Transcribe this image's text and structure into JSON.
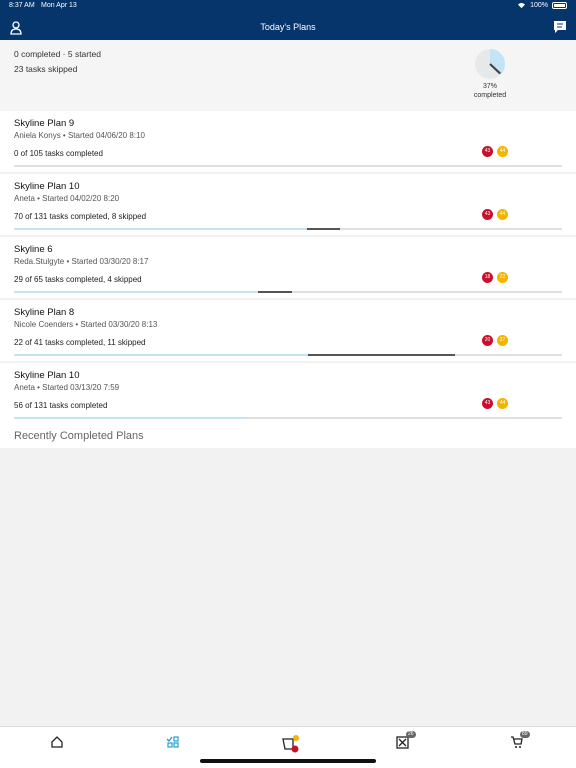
{
  "status": {
    "time": "8:37 AM",
    "date": "Mon Apr 13",
    "battery": "100%"
  },
  "header": {
    "title": "Today's Plans"
  },
  "summary": {
    "line1": "0 completed · 5 started",
    "line2": "23 tasks skipped",
    "pie_percent": "37%",
    "pie_label": "completed",
    "pie_value": 0.37
  },
  "plans": [
    {
      "name": "Skyline Plan 9",
      "meta": "Aniela Konys • Started 04/06/20 8:10",
      "tasks": "0 of 105 tasks completed",
      "red": "43",
      "yellow": "44",
      "done": 0.0,
      "skipped": 0.0
    },
    {
      "name": "Skyline Plan 10",
      "meta": "Aneta • Started 04/02/20 8:20",
      "tasks": "70 of 131 tasks completed, 8 skipped",
      "red": "43",
      "yellow": "44",
      "done": 0.534,
      "skipped": 0.061
    },
    {
      "name": "Skyline 6",
      "meta": "Reda.Stulgyte • Started 03/30/20 8:17",
      "tasks": "29 of 65 tasks completed, 4 skipped",
      "red": "18",
      "yellow": "22",
      "done": 0.446,
      "skipped": 0.062
    },
    {
      "name": "Skyline Plan 8",
      "meta": "Nicole Coenders • Started 03/30/20 8:13",
      "tasks": "22 of 41 tasks completed, 11 skipped",
      "red": "20",
      "yellow": "27",
      "done": 0.537,
      "skipped": 0.268
    },
    {
      "name": "Skyline Plan 10",
      "meta": "Aneta • Started 03/13/20 7:59",
      "tasks": "56 of 131 tasks completed",
      "red": "43",
      "yellow": "44",
      "done": 0.427,
      "skipped": 0.0
    }
  ],
  "recent": {
    "title": "Recently Completed Plans"
  },
  "tabs": {
    "issues_badge": "26",
    "cart_badge": "89"
  },
  "colors": {
    "header": "#05356b",
    "red": "#c8102e",
    "yellow": "#f4b400",
    "accent": "#1a9fd9"
  }
}
